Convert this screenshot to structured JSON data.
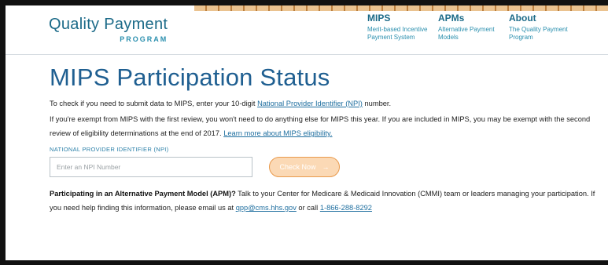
{
  "header": {
    "logo_main": "Quality Payment",
    "logo_sub": "PROGRAM",
    "nav": [
      {
        "title": "MIPS",
        "subtitle": "Merit-based Incentive Payment System"
      },
      {
        "title": "APMs",
        "subtitle": "Alternative Payment Models"
      },
      {
        "title": "About",
        "subtitle": "The Quality Payment Program"
      }
    ]
  },
  "main": {
    "title": "MIPS Participation Status",
    "intro_pre": "To check if you need to submit data to MIPS, enter your 10-digit ",
    "intro_link": "National Provider Identifier (NPI)",
    "intro_post": "  number.",
    "exempt_text": "If you're exempt from MIPS with the first review, you won't need to do anything else for MIPS this year. If you are included in MIPS, you may be exempt with the second review of eligibility determinations at the end of 2017. ",
    "exempt_link": "Learn more about MIPS eligibility.",
    "npi_label": "NATIONAL PROVIDER IDENTIFIER (NPI)",
    "npi_placeholder": "Enter an NPI Number",
    "check_button": "Check Now",
    "check_arrow": "→",
    "apm_bold": "Participating in an Alternative Payment Model (APM)?",
    "apm_text": " Talk to your Center for Medicare & Medicaid Innovation (CMMI) team or leaders managing your participation. If you need help finding this information, please email us at ",
    "apm_email": "qpp@cms.hhs.gov",
    "apm_or": " or call ",
    "apm_phone": "1-866-288-8292"
  },
  "colors": {
    "title": "#1f5f91",
    "link": "#1e6e9f",
    "button_bg": "#fbd9b5",
    "button_border": "#e99a4c"
  }
}
